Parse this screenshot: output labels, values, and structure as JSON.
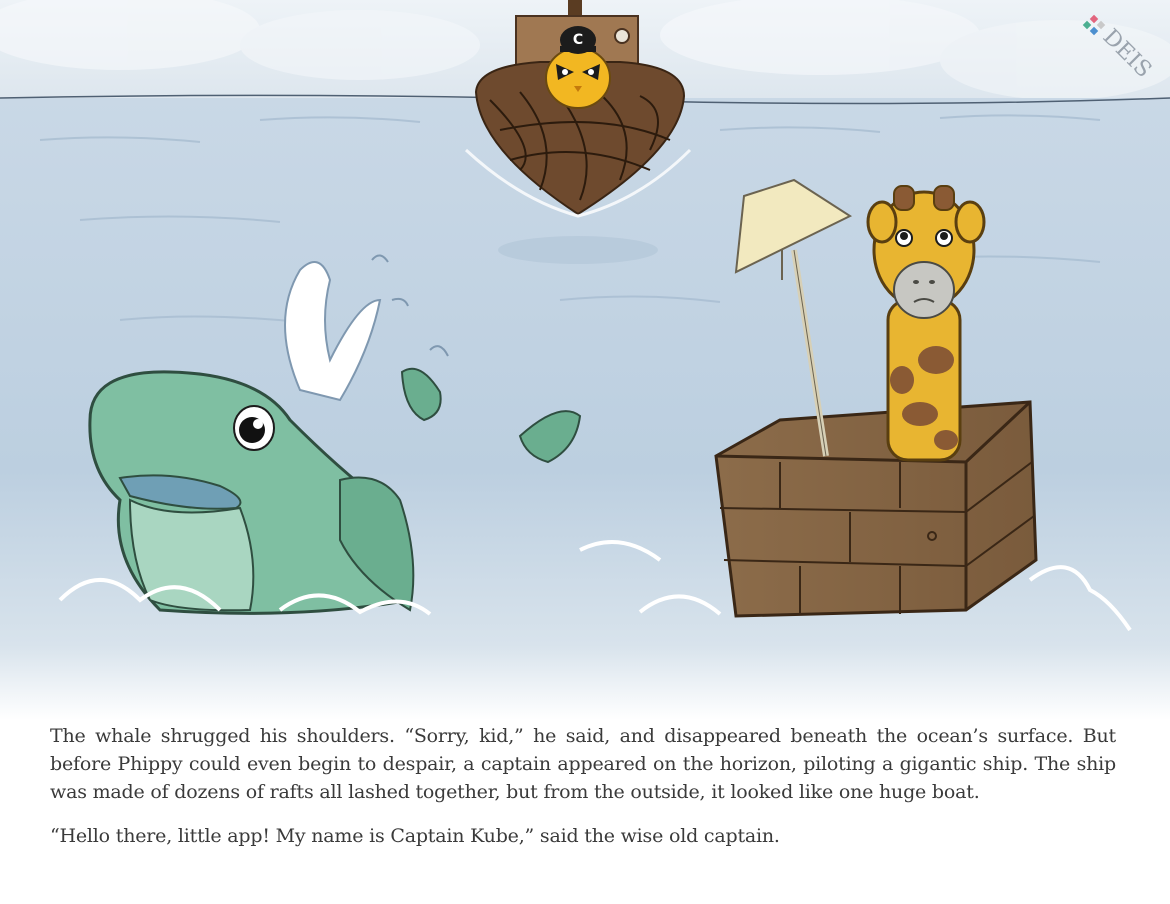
{
  "story": {
    "paragraph_1": "The whale shrugged his shoulders. “Sorry, kid,” he said, and disappeared beneath the ocean’s surface. But before Phippy could even begin to despair, a captain appeared on the horizon, piloting a gigantic ship. The ship was made of dozens of rafts all lashed together, but from the outside, it looked like one huge boat.",
    "paragraph_2": "“Hello there, little app! My name is Captain Kube,” said the wise old captain."
  },
  "logo": {
    "text": "DEIS"
  },
  "captain": {
    "hat_letter": "C"
  },
  "colors": {
    "sky": "#e6edf3",
    "sea": "#c3d4e3",
    "whale": "#7fbfa2",
    "giraffe": "#e8b531",
    "box": "#8a6a48",
    "ship": "#6e4a2e",
    "text": "#3a3a3a"
  }
}
